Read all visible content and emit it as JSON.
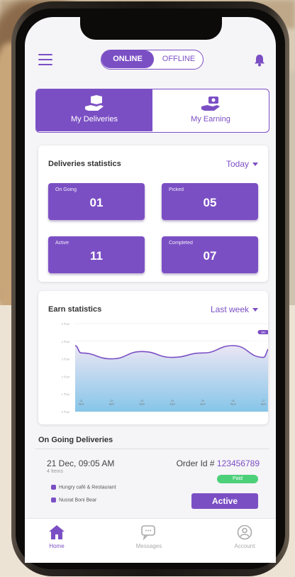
{
  "status_toggle": {
    "online": "ONLINE",
    "offline": "OFFLINE"
  },
  "tabs": [
    {
      "label": "My Deliveries",
      "icon": "delivery-box-icon",
      "active": true
    },
    {
      "label": "My Earning",
      "icon": "earning-icon",
      "active": false
    }
  ],
  "deliveries_stats": {
    "title": "Deliveries statistics",
    "period": "Today",
    "boxes": [
      {
        "label": "On Going",
        "value": "01"
      },
      {
        "label": "Picked",
        "value": "05"
      },
      {
        "label": "Active",
        "value": "11"
      },
      {
        "label": "Completed",
        "value": "07"
      }
    ]
  },
  "earn_stats": {
    "title": "Earn statistics",
    "period": "Last week",
    "highlight_label": "$40"
  },
  "chart_data": {
    "type": "area",
    "title": "Earn statistics",
    "categories": [
      "21 April",
      "22 April",
      "23 April",
      "24 April",
      "25 April",
      "26 April",
      "27 April"
    ],
    "ytick_labels": [
      "0 ₹1M",
      "1 ₹1M",
      "2 ₹1M",
      "3 ₹1M",
      "4 ₹1M",
      "5 ₹1M"
    ],
    "y": [
      4.0,
      3.6,
      4.1,
      3.7,
      4.0,
      4.5,
      3.7
    ],
    "ylim": [
      0,
      6
    ],
    "highlight_index": 6,
    "grid": true,
    "colors": {
      "line": "#7b4fc4",
      "fill_top": "#e8e3f3",
      "fill_bottom": "#79bfe6"
    }
  },
  "ongoing": {
    "title": "On Going Deliveries",
    "datetime": "21 Dec, 09:05 AM",
    "items": "4 Items",
    "order_label": "Order Id # ",
    "order_id": "123456789",
    "payment": "Paid",
    "restaurant": "Hungry café & Restaurant",
    "customer": "Nusrat Boni Bear",
    "status": "Active"
  },
  "bottom_nav": [
    {
      "label": "Home",
      "icon": "home-icon",
      "active": true
    },
    {
      "label": "Messages",
      "icon": "messages-icon",
      "active": false
    },
    {
      "label": "Account",
      "icon": "account-icon",
      "active": false
    }
  ],
  "colors": {
    "accent": "#7b4fc4",
    "paid": "#4cd07a"
  }
}
